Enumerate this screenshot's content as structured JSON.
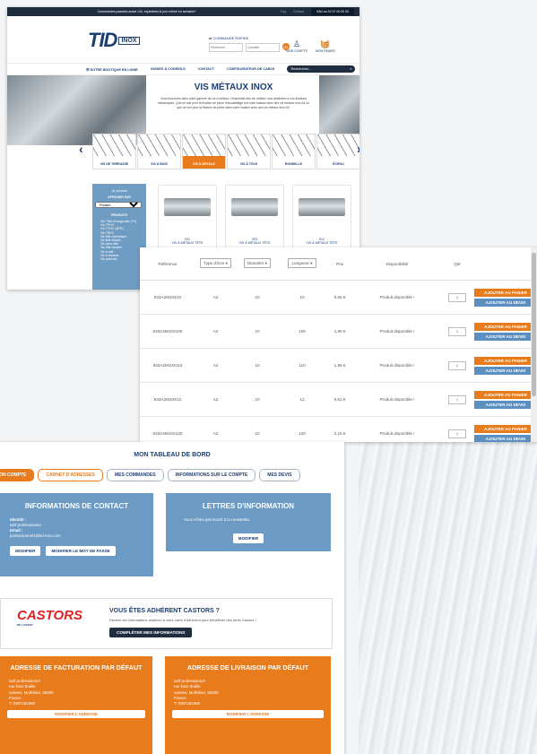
{
  "topbar": {
    "message": "Commandes passées avant 14h, expédiées le jour même en semaine*",
    "links": [
      "Faq",
      "Contact"
    ],
    "sav": "SAV au 02 97 00 00 00"
  },
  "header": {
    "logo_main": "TID",
    "logo_sub": "INOX",
    "quick_title": "COMMANDE RAPIDE",
    "ref_placeholder": "Référence",
    "qty_placeholder": "Quantité",
    "ok_label": "OK",
    "account_label": "MON COMPTE",
    "cart_label": "MON PANIER"
  },
  "nav": {
    "items": [
      "NOTRE BOUTIQUE EN LIGNE",
      "GUIDES & CONSEILS",
      "CONTACT",
      "CONFIGURATEUR DE CABLE"
    ],
    "search_placeholder": "Rechercher..."
  },
  "hero": {
    "title": "VIS MÉTAUX INOX",
    "text": "Vous trouverez dans notre gamme de vis à métaux, l'ensemble des vis métaux inox destinées à vos fixations mécaniques. Que ce soit pour la fixation de pièce d'accastillage sur votre bateau avec des vis métaux inox A4 ou que ce soit pour la fixation de pièce dans votre maison avec des vis métaux inox A2."
  },
  "categories": [
    {
      "label": "VIS DE TERRASSE",
      "active": false
    },
    {
      "label": "VIS À BOIS",
      "active": false
    },
    {
      "label": "VIS À MÉTAUX",
      "active": true
    },
    {
      "label": "VIS À TÔLE",
      "active": false
    },
    {
      "label": "RONDELLE",
      "active": false
    },
    {
      "label": "ÉCROU",
      "active": false
    }
  ],
  "filter": {
    "count": "16 produits",
    "sort_label": "AFFICHER PAR",
    "sort_value": "Position",
    "products_title": "PRODUITS",
    "items": [
      "Vis Tête Hexagonale (TH)",
      "Vis TPHC",
      "Vis TCHC (BTR)",
      "Vis TBHC",
      "Vis tête cylindrique",
      "Vis tête fraisée",
      "Vis sans tête",
      "Vis tête moulée",
      "Vis à oeil",
      "Vis à anneau",
      "Vis spéciale"
    ]
  },
  "products": [
    {
      "sku": "931",
      "name": "VIS À MÉTAUX TÊTE"
    },
    {
      "sku": "933",
      "name": "VIS À MÉTAUX TÊTE"
    },
    {
      "sku": "912",
      "name": "VIS À MÉTAUX TÊTE"
    }
  ],
  "table": {
    "headers": {
      "ref": "Référence",
      "type": "Type d'inox",
      "diam": "Diamètre",
      "len": "Longueur",
      "price": "Prix",
      "dispo": "Disponibilité",
      "qty": "Qté"
    },
    "cart_label": "AJOUTER AU PANIER",
    "quote_label": "AJOUTER AU DEVIS",
    "rows": [
      {
        "ref": "933A2M10X10",
        "type": "A2",
        "diam": "10",
        "len": "10",
        "price": "0,66 €",
        "dispo": "Produit disponible !",
        "qty": "1"
      },
      {
        "ref": "933A2M10X100",
        "type": "A2",
        "diam": "10",
        "len": "100",
        "price": "1,80 €",
        "dispo": "Produit disponible !",
        "qty": "1"
      },
      {
        "ref": "933A2M10X110",
        "type": "A2",
        "diam": "10",
        "len": "110",
        "price": "1,99 €",
        "dispo": "Produit disponible !",
        "qty": "1"
      },
      {
        "ref": "933A2M10X12",
        "type": "A2",
        "diam": "10",
        "len": "12",
        "price": "0,61 €",
        "dispo": "Produit disponible !",
        "qty": "1"
      },
      {
        "ref": "933A2M10X120",
        "type": "A2",
        "diam": "10",
        "len": "120",
        "price": "2,16 €",
        "dispo": "Produit disponible !",
        "qty": "1"
      }
    ]
  },
  "dashboard": {
    "title": "MON TABLEAU DE BORD",
    "tabs": [
      "MON COMPTE",
      "CARNET D'ADRESSES",
      "MES COMMANDES",
      "INFORMATIONS SUR LE COMPTE",
      "MES DEVIS"
    ],
    "contact": {
      "title": "INFORMATIONS DE CONTACT",
      "identity_label": "Identité :",
      "identity_value": "tarif professionnel",
      "email_label": "Email :",
      "email_value": "professionnel1@tid-inox.com",
      "modify": "MODIFIER",
      "modify_password": "MODIFIER LE MOT DE PASSE"
    },
    "newsletter": {
      "title": "LETTRES D'INFORMATION",
      "text": "Vous n'êtes pas inscrit à la newsletter.",
      "modify": "MODIFIER"
    },
    "castors": {
      "logo": "CASTORS",
      "logo_tag": "DE L'OUEST",
      "title": "VOUS ÊTES ADHÉRENT CASTORS ?",
      "text": "Rentrer les informations relatives à votre carte d'adhérent pour bénéficier des tarifs Castors !",
      "button": "COMPLÉTER MES INFORMATIONS"
    },
    "billing": {
      "title": "ADRESSE DE FACTURATION PAR DÉFAUT",
      "lines": [
        "tarif professionnel",
        "rue louis braille",
        "vannes, Morbihan, 56000",
        "France",
        "T: 0297451090"
      ],
      "modify": "MODIFIER L'ADRESSE"
    },
    "shipping": {
      "title": "ADRESSE DE LIVRAISON PAR DÉFAUT",
      "lines": [
        "tarif professionnel",
        "rue louis braille",
        "vannes, Morbihan, 56000",
        "France",
        "T: 0297451090"
      ],
      "modify": "MODIFIER L'ADRESSE"
    }
  }
}
